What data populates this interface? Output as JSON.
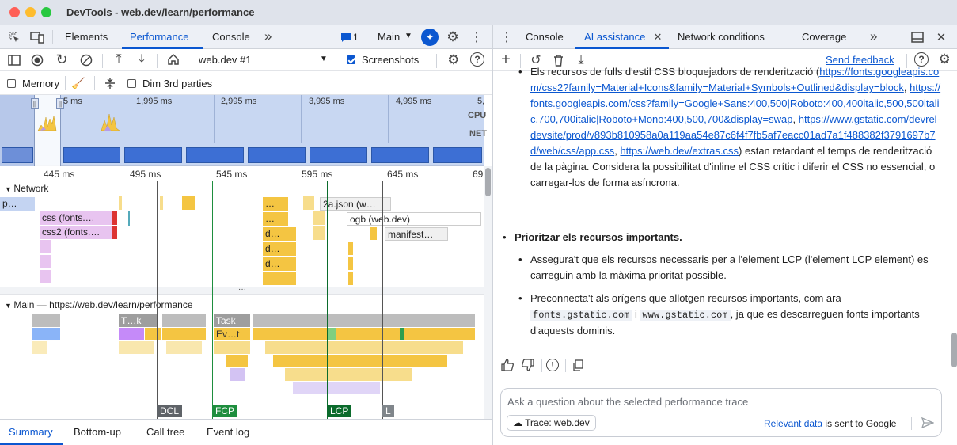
{
  "window": {
    "title": "DevTools - web.dev/learn/performance"
  },
  "left_tabs": [
    {
      "label": "Elements",
      "active": false
    },
    {
      "label": "Performance",
      "active": true
    },
    {
      "label": "Console",
      "active": false
    }
  ],
  "left_tabbar": {
    "more": "»",
    "badge_count": "1",
    "context": "Main"
  },
  "perf_toolbar": {
    "recording": "web.dev #1",
    "screenshots_label": "Screenshots",
    "screenshots_checked": true
  },
  "perf_toolbar2": {
    "memory_label": "Memory",
    "dim_label": "Dim 3rd parties"
  },
  "overview": {
    "ticks": [
      "5 ms",
      "1,995 ms",
      "2,995 ms",
      "3,995 ms",
      "4,995 ms",
      "5,"
    ],
    "cpu_label": "CPU",
    "net_label": "NET"
  },
  "timeline_ticks": [
    "445 ms",
    "495 ms",
    "545 ms",
    "595 ms",
    "645 ms",
    "69"
  ],
  "network": {
    "label": "Network",
    "requests": [
      "p…",
      "css (fonts.…",
      "css2 (fonts.…",
      "2a.json (w…",
      "ogb (web.dev)",
      "manifest…",
      "…",
      "…",
      "d…",
      "d…",
      "d…"
    ]
  },
  "main_track": {
    "label": "Main — https://web.dev/learn/performance",
    "task_labels": [
      "T…k",
      "Task",
      "Ev…t"
    ]
  },
  "markers": {
    "dcl": "DCL",
    "fcp": "FCP",
    "lcp": "LCP",
    "l": "L"
  },
  "bottom_tabs": [
    {
      "label": "Summary",
      "active": true
    },
    {
      "label": "Bottom-up",
      "active": false
    },
    {
      "label": "Call tree",
      "active": false
    },
    {
      "label": "Event log",
      "active": false
    }
  ],
  "right_tabs": [
    {
      "label": "Console",
      "active": false
    },
    {
      "label": "AI assistance",
      "active": true
    },
    {
      "label": "Network conditions",
      "active": false
    },
    {
      "label": "Coverage",
      "active": false
    }
  ],
  "ai_toolbar": {
    "send_feedback": "Send feedback"
  },
  "ai_content": {
    "p1_intro": "Els recursos de fulls d'estil CSS bloquejadors de renderització (",
    "link1": "https://fonts.googleapis.com/css2?family=Material+Icons&family=Material+Symbols+Outlined&display=block",
    "link2": "https://fonts.googleapis.com/css?family=Google+Sans:400,500|Roboto:400,400italic,500,500italic,700,700italic|Roboto+Mono:400,500,700&display=swap",
    "link3": "https://www.gstatic.com/devrel-devsite/prod/v893b810958a0a119aa54e87c6f4f7fb5af7eacc01ad7a1f488382f3791697b7d/web/css/app.css",
    "link4": "https://web.dev/extras.css",
    "p1_end": ") estan retardant el temps de renderització de la pàgina. Considera la possibilitat d'inline el CSS crític i diferir el CSS no essencial, o carregar-los de forma asíncrona.",
    "heading2": "Prioritzar els recursos importants.",
    "p2": "Assegura't que els recursos necessaris per a l'element LCP (l'element LCP element) es carreguin amb la màxima prioritat possible.",
    "p3_a": "Preconnecta't als orígens que allotgen recursos importants, com ara ",
    "code1": "fonts.gstatic.com",
    "p3_b": " i ",
    "code2": "www.gstatic.com",
    "p3_c": ", ja que es descarreguen fonts importants d'aquests dominis."
  },
  "ai_input": {
    "placeholder": "Ask a question about the selected performance trace",
    "trace_chip": "Trace: web.dev",
    "relevant_link": "Relevant data",
    "relevant_suffix": " is sent to Google"
  },
  "colors": {
    "accent": "#0b57d0",
    "script": "#f4c542",
    "render": "#b59be8",
    "paint": "#7fcf7f",
    "task": "#9e9e9e",
    "css": "#e8c4f0"
  }
}
